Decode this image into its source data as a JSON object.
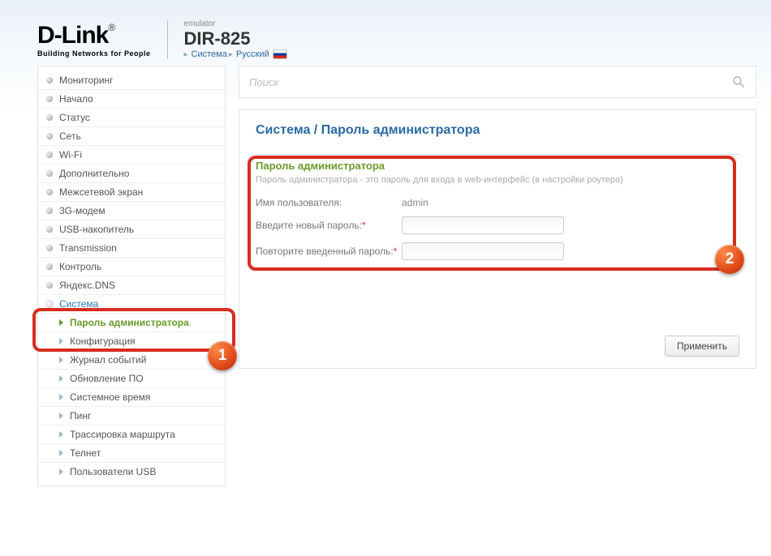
{
  "brand": {
    "name": "D-Link",
    "tagline": "Building Networks for People",
    "reg": "®"
  },
  "device": {
    "emulator": "emulator",
    "model": "DIR-825"
  },
  "top_crumbs": {
    "section": "Система",
    "lang": "Русский"
  },
  "search": {
    "placeholder": "Поиск"
  },
  "sidebar": {
    "items": [
      {
        "label": "Мониторинг"
      },
      {
        "label": "Начало"
      },
      {
        "label": "Статус"
      },
      {
        "label": "Сеть"
      },
      {
        "label": "Wi-Fi"
      },
      {
        "label": "Дополнительно"
      },
      {
        "label": "Межсетевой экран"
      },
      {
        "label": "3G-модем"
      },
      {
        "label": "USB-накопитель"
      },
      {
        "label": "Transmission"
      },
      {
        "label": "Контроль"
      },
      {
        "label": "Яндекс.DNS"
      },
      {
        "label": "Система",
        "active": true,
        "children": [
          {
            "label": "Пароль администратора",
            "active": true
          },
          {
            "label": "Конфигурация"
          },
          {
            "label": "Журнал событий"
          },
          {
            "label": "Обновление ПО"
          },
          {
            "label": "Системное время"
          },
          {
            "label": "Пинг"
          },
          {
            "label": "Трассировка маршрута"
          },
          {
            "label": "Телнет"
          },
          {
            "label": "Пользователи USB"
          }
        ]
      }
    ]
  },
  "page": {
    "breadcrumb": "Система /  Пароль администратора",
    "panel_title": "Пароль администратора",
    "panel_desc": "Пароль администратора - это пароль для входа в web-интерфейс (в настройки роутера)",
    "username_label": "Имя пользователя:",
    "username_value": "admin",
    "newpass_label": "Введите новый пароль:",
    "repeat_label": "Повторите введенный пароль:",
    "apply": "Применить"
  },
  "annotations": {
    "b1": "1",
    "b2": "2"
  }
}
